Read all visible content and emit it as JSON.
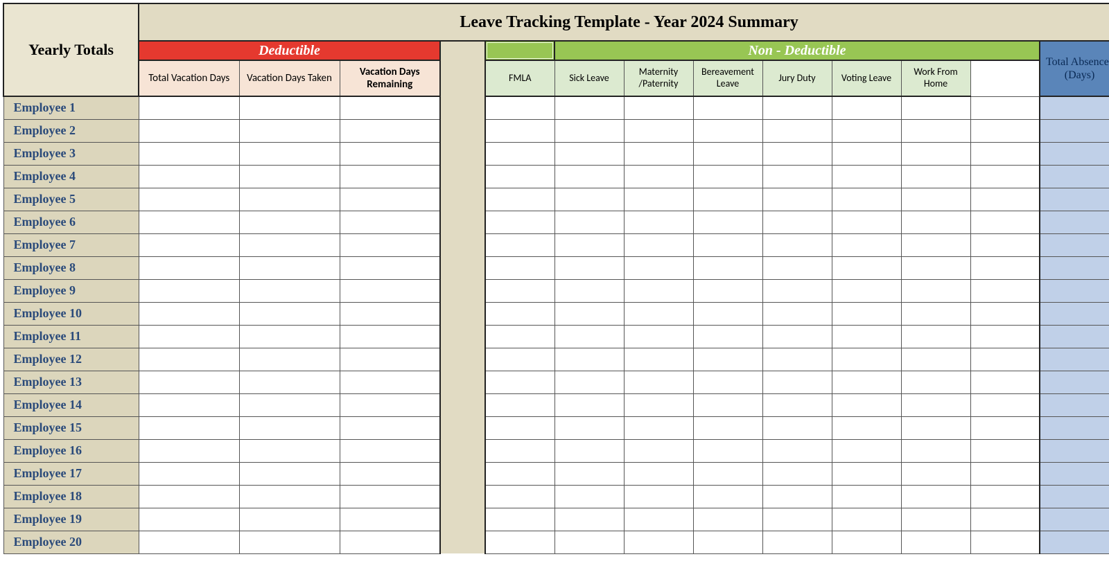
{
  "title": "Leave Tracking Template - Year 2024 Summary",
  "yearly_totals_label": "Yearly Totals",
  "deductible_label": "Deductible",
  "nondeductible_label": "Non - Deductible",
  "total_absences_label": "Total Absences (Days)",
  "deductible_columns": [
    "Total Vacation Days",
    "Vacation Days Taken",
    "Vacation Days Remaining"
  ],
  "nondeductible_columns": [
    "FMLA",
    "Sick Leave",
    "Maternity /Paternity",
    "Bereavement Leave",
    "Jury Duty",
    "Voting Leave",
    "Work From Home"
  ],
  "employees": [
    "Employee 1",
    "Employee 2",
    "Employee 3",
    "Employee 4",
    "Employee 5",
    "Employee 6",
    "Employee 7",
    "Employee 8",
    "Employee 9",
    "Employee 10",
    "Employee 11",
    "Employee 12",
    "Employee 13",
    "Employee 14",
    "Employee 15",
    "Employee 16",
    "Employee 17",
    "Employee 18",
    "Employee 19",
    "Employee 20"
  ]
}
